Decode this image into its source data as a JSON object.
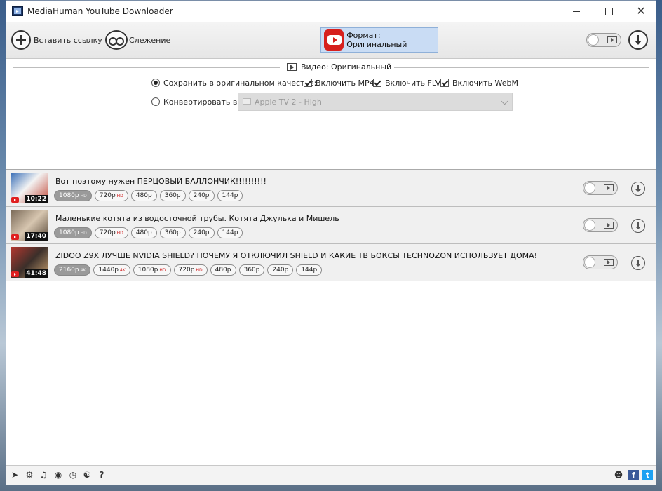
{
  "window": {
    "title": "MediaHuman YouTube Downloader",
    "minimize": "minimize",
    "maximize": "maximize",
    "close": "✕"
  },
  "toolbar": {
    "paste_label": "Вставить ссылку",
    "tracking_label": "Слежение",
    "format_label": "Формат: Оригинальный"
  },
  "settings": {
    "section_title": "Видео: Оригинальный",
    "save_original_label": "Сохранить в оригинальном качестве:",
    "save_original_selected": true,
    "mp4_label": "Включить MP4",
    "mp4_checked": true,
    "flv_label": "Включить FLV",
    "flv_checked": true,
    "webm_label": "Включить WebM",
    "webm_checked": true,
    "convert_label": "Конвертировать в:",
    "convert_selected": false,
    "convert_value": "Apple TV 2 - High"
  },
  "videos": [
    {
      "title": "Вот поэтому нужен ПЕРЦОВЫЙ БАЛЛОНЧИК!!!!!!!!!!",
      "duration": "10:22",
      "qualities": [
        {
          "label": "1080p",
          "tag": "HD",
          "selected": true
        },
        {
          "label": "720p",
          "tag": "HD",
          "selected": false
        },
        {
          "label": "480p",
          "tag": "",
          "selected": false
        },
        {
          "label": "360p",
          "tag": "",
          "selected": false
        },
        {
          "label": "240p",
          "tag": "",
          "selected": false
        },
        {
          "label": "144p",
          "tag": "",
          "selected": false
        }
      ]
    },
    {
      "title": "Маленькие котята из водосточной трубы. Котята Джулька и Мишель",
      "duration": "17:40",
      "qualities": [
        {
          "label": "1080p",
          "tag": "HD",
          "selected": true
        },
        {
          "label": "720p",
          "tag": "HD",
          "selected": false
        },
        {
          "label": "480p",
          "tag": "",
          "selected": false
        },
        {
          "label": "360p",
          "tag": "",
          "selected": false
        },
        {
          "label": "240p",
          "tag": "",
          "selected": false
        },
        {
          "label": "144p",
          "tag": "",
          "selected": false
        }
      ]
    },
    {
      "title": "ZIDOO Z9X ЛУЧШЕ NVIDIA SHIELD? ПОЧЕМУ Я ОТКЛЮЧИЛ SHIELD И КАКИЕ ТВ БОКСЫ TECHNOZON ИСПОЛЬЗУЕТ ДОМА!",
      "duration": "41:48",
      "qualities": [
        {
          "label": "2160p",
          "tag": "4K",
          "selected": true
        },
        {
          "label": "1440p",
          "tag": "4K",
          "selected": false
        },
        {
          "label": "1080p",
          "tag": "HD",
          "selected": false
        },
        {
          "label": "720p",
          "tag": "HD",
          "selected": false
        },
        {
          "label": "480p",
          "tag": "",
          "selected": false
        },
        {
          "label": "360p",
          "tag": "",
          "selected": false
        },
        {
          "label": "240p",
          "tag": "",
          "selected": false
        },
        {
          "label": "144p",
          "tag": "",
          "selected": false
        }
      ]
    }
  ],
  "statusbar": {
    "help_label": "?",
    "facebook_label": "f",
    "twitter_label": "t"
  },
  "colors": {
    "youtube_red": "#d6201e",
    "format_button_bg": "#c9dcf4",
    "selected_chip": "#9a9a9a",
    "facebook": "#3b5998",
    "twitter": "#1da1f2"
  },
  "icons": {
    "app": "app-film-icon",
    "paste": "plus-circle-icon",
    "tracking": "binoculars-icon",
    "format": "youtube-icon",
    "download": "download-arrow-icon",
    "status": [
      "telegram-icon",
      "gear-icon",
      "music-note-icon",
      "snail-icon",
      "clock-icon",
      "binoculars-icon",
      "help-icon",
      "user-icon",
      "facebook-icon",
      "twitter-icon"
    ]
  }
}
